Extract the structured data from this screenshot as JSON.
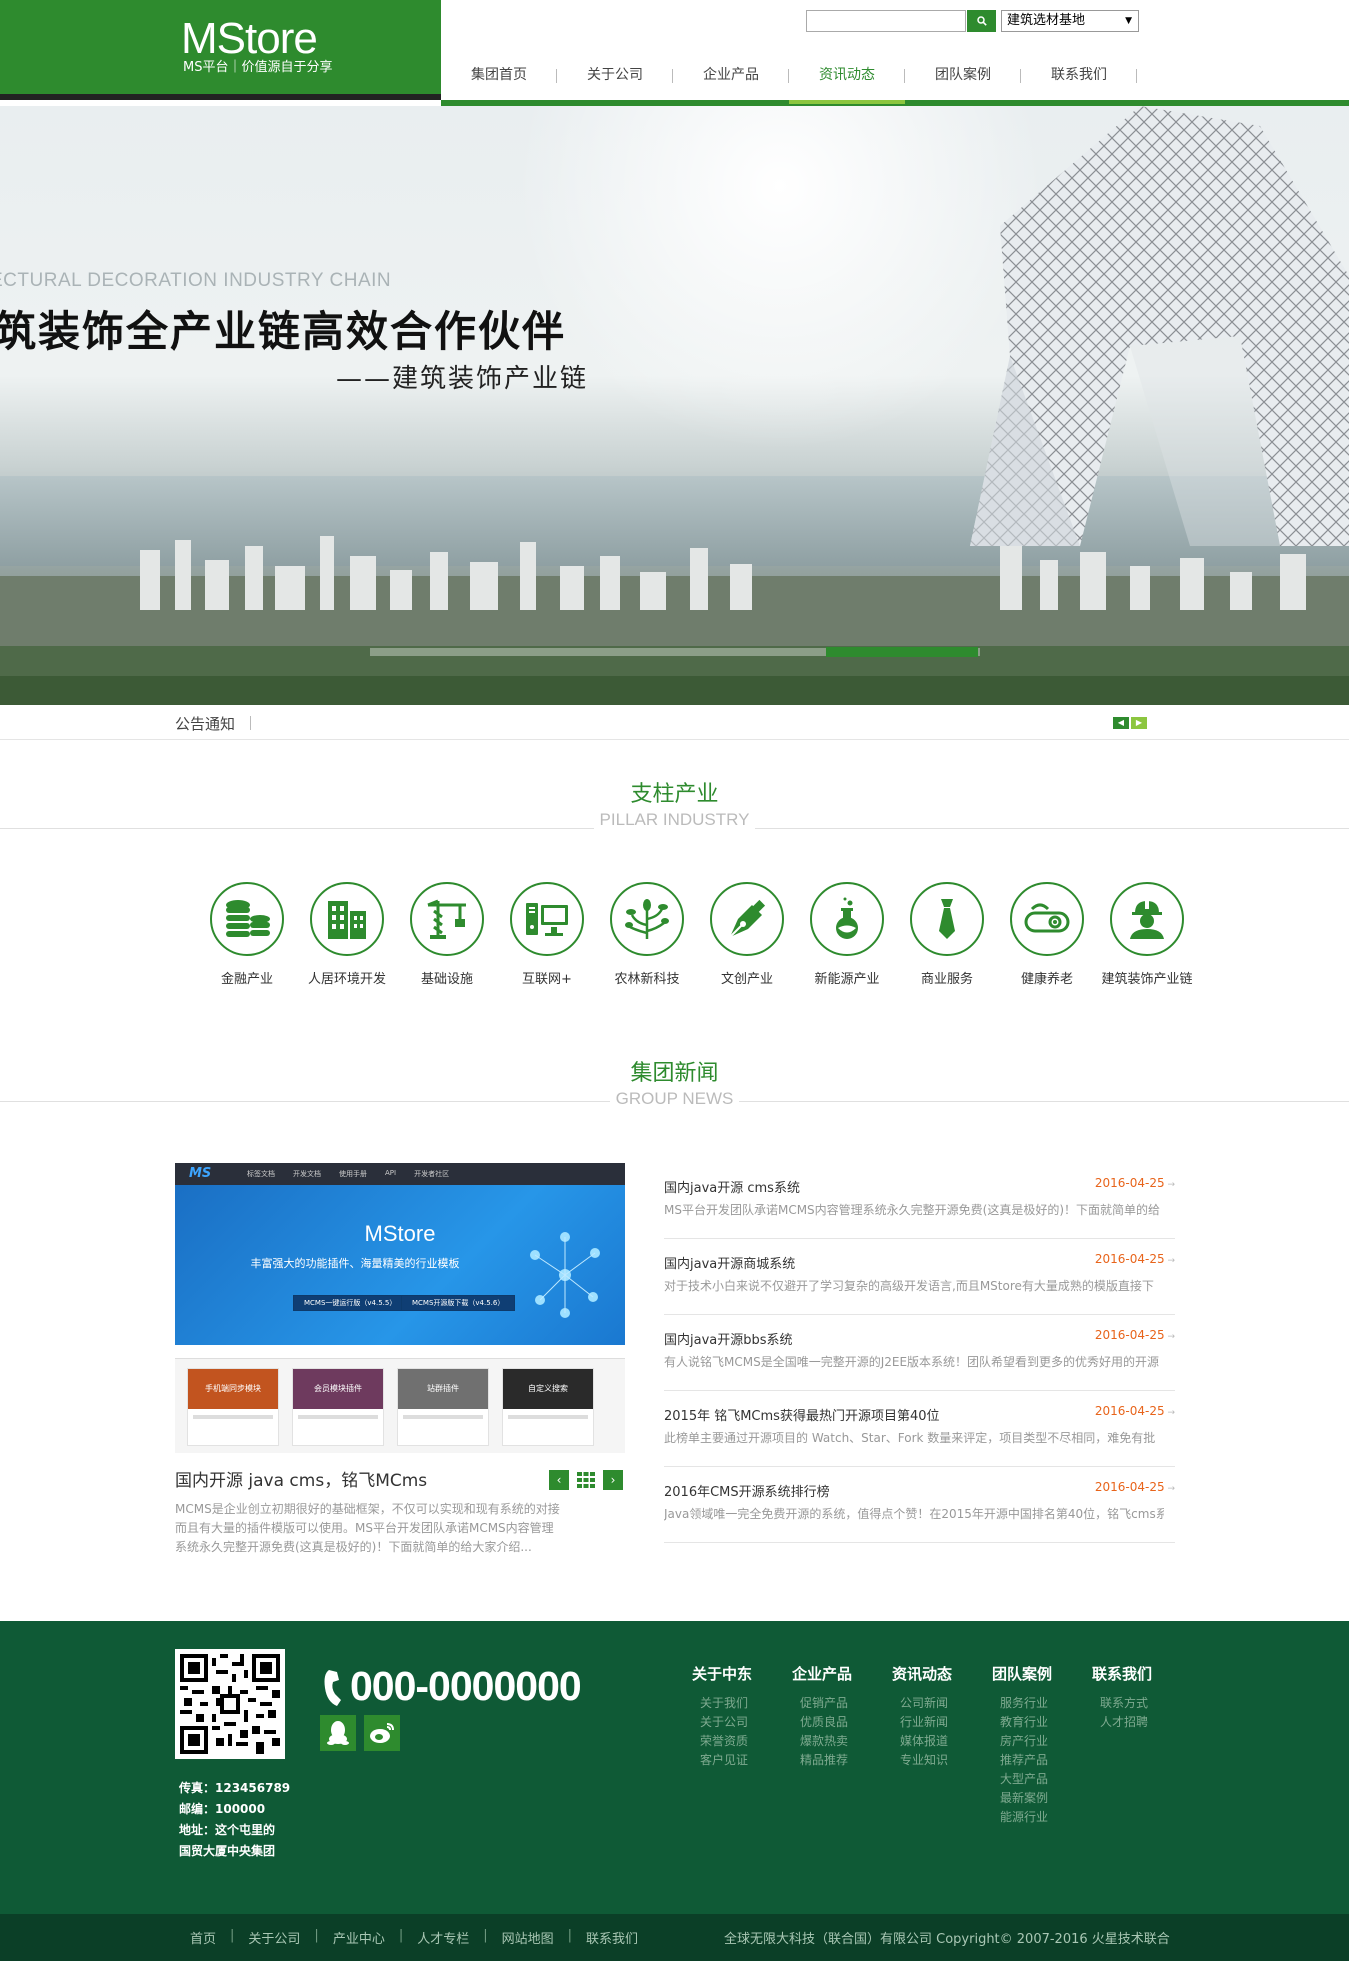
{
  "logo": {
    "title": "MStore",
    "subtitle": "MS平台｜价值源自于分享"
  },
  "search": {
    "button_icon": "search-icon",
    "select_value": "建筑选材基地"
  },
  "nav": {
    "items": [
      "集团首页",
      "关于公司",
      "企业产品",
      "资讯动态",
      "团队案例",
      "联系我们"
    ],
    "active_index": 3
  },
  "banner": {
    "en_text": "ECTURAL DECORATION INDUSTRY CHAIN",
    "cn_text": "筑装饰全产业链高效合作伙伴",
    "sub_text": "——建筑装饰产业链"
  },
  "notice": {
    "label": "公告通知"
  },
  "pillar": {
    "title_cn": "支柱产业",
    "title_en": "PILLAR INDUSTRY",
    "items": [
      {
        "label": "金融产业",
        "icon": "coins-icon"
      },
      {
        "label": "人居环境开发",
        "icon": "buildings-icon"
      },
      {
        "label": "基础设施",
        "icon": "crane-icon"
      },
      {
        "label": "互联网+",
        "icon": "computer-icon"
      },
      {
        "label": "农林新科技",
        "icon": "plant-icon"
      },
      {
        "label": "文创产业",
        "icon": "pen-nib-icon"
      },
      {
        "label": "新能源产业",
        "icon": "flask-icon"
      },
      {
        "label": "商业服务",
        "icon": "tie-icon"
      },
      {
        "label": "健康养老",
        "icon": "capsule-icon"
      },
      {
        "label": "建筑装饰产业链",
        "icon": "worker-icon"
      }
    ]
  },
  "news": {
    "title_cn": "集团新闻",
    "title_en": "GROUP NEWS",
    "feature": {
      "screenshot": {
        "logo": "MS",
        "menu": [
          "标签文档",
          "开发文档",
          "使用手册",
          "API",
          "开发者社区"
        ],
        "title": "MStore",
        "subtitle": "丰富强大的功能插件、海量精美的行业模板",
        "btn1": "MCMS一键运行版（v4.5.5）",
        "btn2": "MCMS开源版下载（v4.5.6）",
        "cards": [
          "手机端同步模块",
          "会员模块插件",
          "站群插件",
          "自定义搜索"
        ]
      },
      "title": "国内开源 java cms，铭飞MCms",
      "desc": "MCMS是企业创立初期很好的基础框架，不仅可以实现和现有系统的对接而且有大量的插件模版可以使用。MS平台开发团队承诺MCMS内容管理系统永久完整开源免费(这真是极好的)！下面就简单的给大家介绍..."
    },
    "items": [
      {
        "title": "国内java开源 cms系统",
        "date": "2016-04-25",
        "summary": "MS平台开发团队承诺MCMS内容管理系统永久完整开源免费(这真是极好的)！下面就简单的给"
      },
      {
        "title": "国内java开源商城系统",
        "date": "2016-04-25",
        "summary": "对于技术小白来说不仅避开了学习复杂的高级开发语言,而且MStore有大量成熟的模版直接下"
      },
      {
        "title": "国内java开源bbs系统",
        "date": "2016-04-25",
        "summary": "有人说铭飞MCMS是全国唯一完整开源的J2EE版本系统！团队希望看到更多的优秀好用的开源"
      },
      {
        "title": "2015年 铭飞MCms获得最热门开源项目第40位",
        "date": "2016-04-25",
        "summary": "此榜单主要通过开源项目的 Watch、Star、Fork 数量来评定，项目类型不尽相同，难免有批"
      },
      {
        "title": "2016年CMS开源系统排行榜",
        "date": "2016-04-25",
        "summary": "Java领域唯一完全免费开源的系统，值得点个赞！在2015年开源中国排名第40位，铭飞cms系"
      }
    ]
  },
  "footer": {
    "phone": "000-0000000",
    "fax": "传真：123456789",
    "postcode": "邮编：100000",
    "address1": "地址：这个屯里的",
    "address2": "国贸大厦中央集团",
    "columns": [
      {
        "title": "关于中东",
        "links": [
          "关于我们",
          "关于公司",
          "荣誉资质",
          "客户见证"
        ]
      },
      {
        "title": "企业产品",
        "links": [
          "促销产品",
          "优质良品",
          "爆款热卖",
          "精品推荐"
        ]
      },
      {
        "title": "资讯动态",
        "links": [
          "公司新闻",
          "行业新闻",
          "媒体报道",
          "专业知识"
        ]
      },
      {
        "title": "团队案例",
        "links": [
          "服务行业",
          "教育行业",
          "房产行业",
          "推荐产品",
          "大型产品",
          "最新案例",
          "能源行业"
        ]
      },
      {
        "title": "联系我们",
        "links": [
          "联系方式",
          "人才招聘"
        ]
      }
    ],
    "bottom_links": [
      "首页",
      "关于公司",
      "产业中心",
      "人才专栏",
      "网站地图",
      "联系我们"
    ],
    "copyright": "全球无限大科技（联合国）有限公司 Copyright© 2007-2016 火星技术联合"
  },
  "colors": {
    "brand_green": "#2e8b2e",
    "light_green": "#8cc63f",
    "footer_green": "#0f5a36",
    "date_orange": "#e8641b"
  }
}
